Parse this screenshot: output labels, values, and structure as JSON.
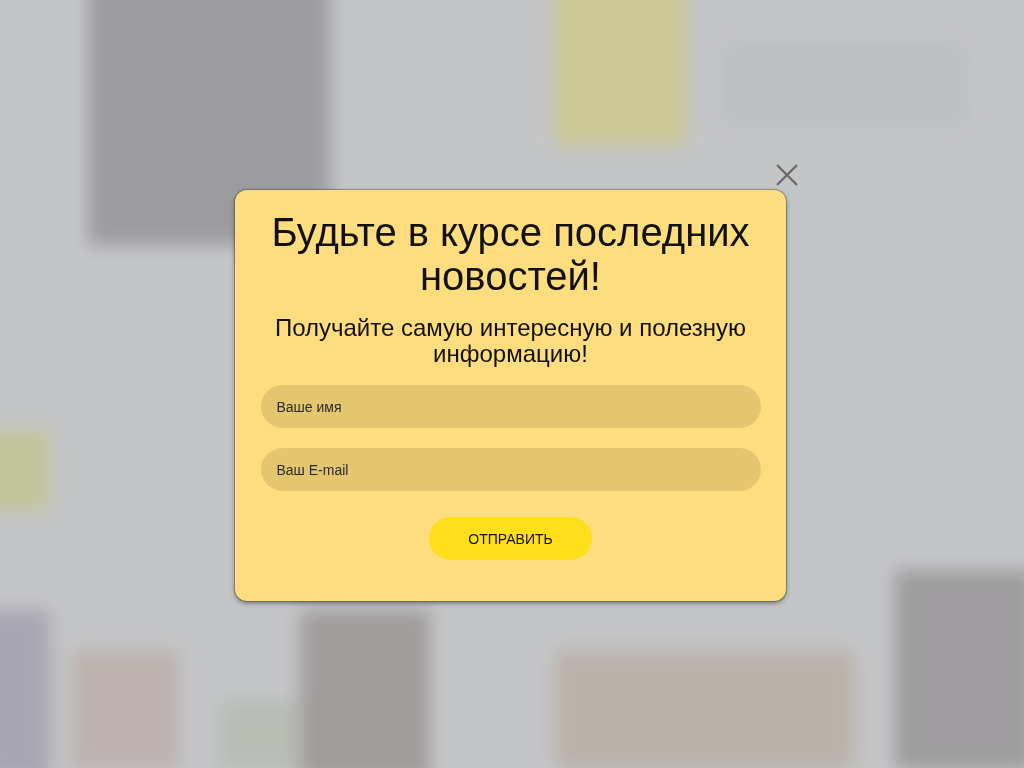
{
  "popup": {
    "title": "Будьте в курсе последних новостей!",
    "subtitle": "Получайте самую интересную и полезную информацию!",
    "fields": [
      {
        "placeholder": "Ваше имя"
      },
      {
        "placeholder": "Ваш E-mail"
      }
    ],
    "submit_button": "ОТПРАВИТЬ"
  }
}
